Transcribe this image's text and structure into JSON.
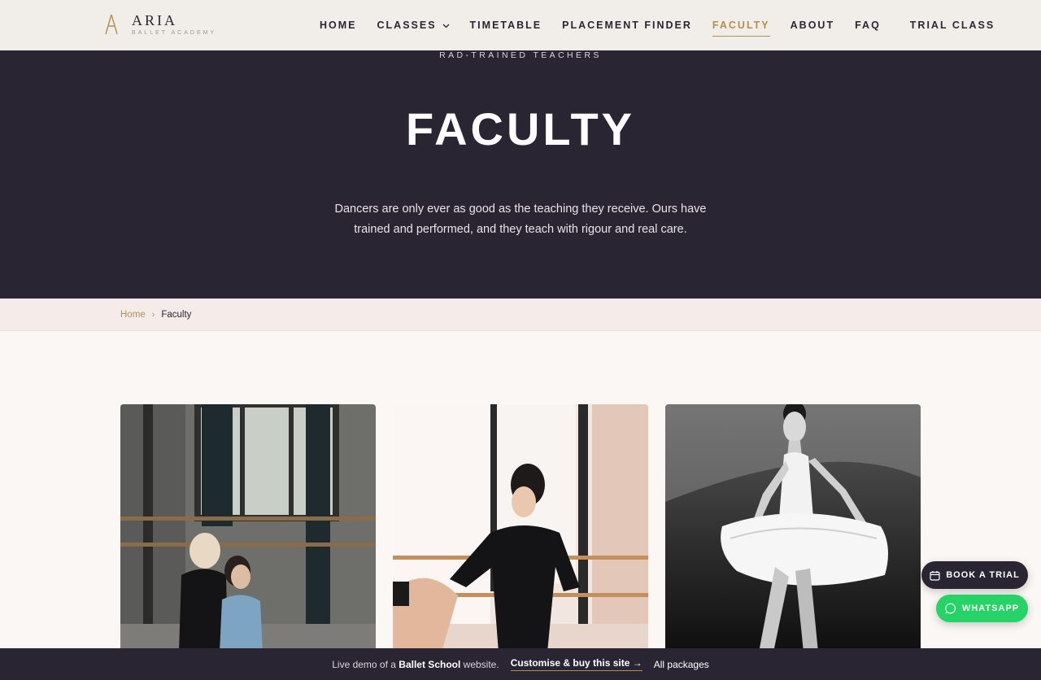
{
  "header": {
    "logo_title": "ARIA",
    "logo_subtitle": "BALLET ACADEMY",
    "nav": [
      {
        "label": "HOME"
      },
      {
        "label": "CLASSES"
      },
      {
        "label": "TIMETABLE"
      },
      {
        "label": "PLACEMENT FINDER"
      },
      {
        "label": "FACULTY"
      },
      {
        "label": "ABOUT"
      },
      {
        "label": "FAQ"
      },
      {
        "label": "TRIAL CLASS"
      }
    ],
    "active": "FACULTY"
  },
  "hero": {
    "eyebrow": "RAD-TRAINED TEACHERS",
    "title": "FACULTY",
    "lead": "Dancers are only ever as good as the teaching they receive. Ours have trained and performed, and they teach with rigour and real care."
  },
  "breadcrumb": {
    "home": "Home",
    "separator": "›",
    "current": "Faculty"
  },
  "floating": {
    "book_trial": "BOOK A TRIAL",
    "whatsapp": "WHATSAPP"
  },
  "demo_bar": {
    "prefix": "Live demo of a",
    "site_type": "Ballet School",
    "suffix": "website.",
    "cta": "Customise & buy this site →",
    "all": "All packages"
  },
  "colors": {
    "accent": "#b38f4d",
    "dark": "#2a2532",
    "whatsapp": "#25d366"
  }
}
